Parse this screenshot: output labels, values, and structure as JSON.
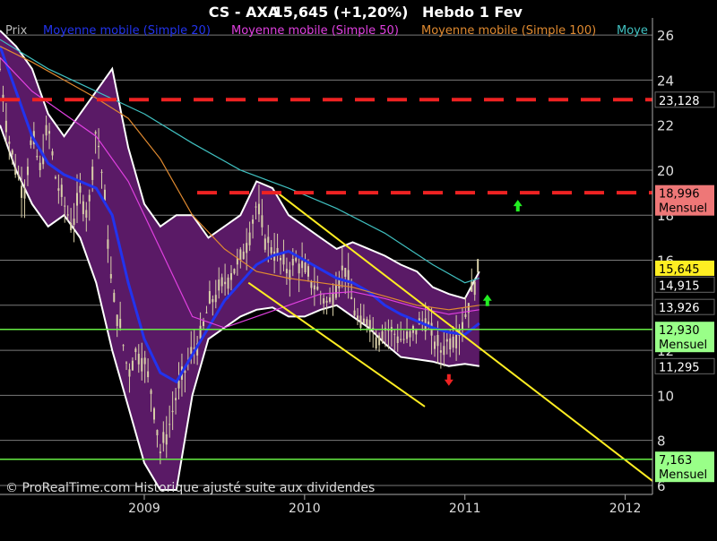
{
  "header": {
    "symbol": "CS - AXA",
    "price_change": "15,645 (+1,20%)",
    "period": "Hebdo  1 Fev"
  },
  "legend": [
    {
      "label": "Prix",
      "color": "#bbbbbb"
    },
    {
      "label": "Moyenne mobile (Simple 20)",
      "color": "#2233ee"
    },
    {
      "label": "Moyenne mobile (Simple 50)",
      "color": "#e040e0"
    },
    {
      "label": "Moyenne mobile (Simple 100)",
      "color": "#e08a30"
    },
    {
      "label": "Moye",
      "color": "#40c0c0"
    }
  ],
  "footer": {
    "copyright": "© ProRealTime.com Historique ajusté suite aux dividendes"
  },
  "colors": {
    "background": "#000000",
    "band_fill": "#5a1a66",
    "band_edge": "#ffffff",
    "candle": "#d8cfa8",
    "resistance": "#ee2222",
    "support": "#66ee44",
    "channel": "#ffee22",
    "grid": "#7a7a7a"
  },
  "chart_data": {
    "type": "line",
    "x_axis": {
      "labels": [
        "2009",
        "2010",
        "2011",
        "2012"
      ],
      "values": [
        2009,
        2010,
        2011,
        2012
      ],
      "range": [
        2008.1,
        2012.17
      ]
    },
    "y_axis": {
      "ticks": [
        6,
        8,
        10,
        12,
        14,
        16,
        18,
        20,
        22,
        24,
        26
      ],
      "range": [
        5.6,
        26.6
      ]
    },
    "price": {
      "x": [
        2008.1,
        2008.15,
        2008.2,
        2008.25,
        2008.3,
        2008.35,
        2008.4,
        2008.45,
        2008.5,
        2008.55,
        2008.6,
        2008.65,
        2008.7,
        2008.75,
        2008.8,
        2008.85,
        2008.9,
        2008.95,
        2009.0,
        2009.05,
        2009.1,
        2009.15,
        2009.2,
        2009.25,
        2009.3,
        2009.35,
        2009.4,
        2009.45,
        2009.5,
        2009.55,
        2009.6,
        2009.65,
        2009.7,
        2009.75,
        2009.8,
        2009.85,
        2009.9,
        2009.95,
        2010.0,
        2010.05,
        2010.1,
        2010.15,
        2010.2,
        2010.25,
        2010.3,
        2010.35,
        2010.4,
        2010.45,
        2010.5,
        2010.55,
        2010.6,
        2010.65,
        2010.7,
        2010.75,
        2010.8,
        2010.85,
        2010.9,
        2010.95,
        2011.0,
        2011.05,
        2011.09
      ],
      "y": [
        24.5,
        21.5,
        20.0,
        19.0,
        21.5,
        20.0,
        22.0,
        19.5,
        18.5,
        17.5,
        19.0,
        18.0,
        22.0,
        19.0,
        14.5,
        13.0,
        11.0,
        12.0,
        11.5,
        10.0,
        7.5,
        8.5,
        10.0,
        11.0,
        12.0,
        12.5,
        14.0,
        14.5,
        15.0,
        15.5,
        16.0,
        17.0,
        18.5,
        17.0,
        16.5,
        16.0,
        15.5,
        16.0,
        15.5,
        15.0,
        14.5,
        14.0,
        15.0,
        15.8,
        14.0,
        13.0,
        13.5,
        12.5,
        13.0,
        12.8,
        12.5,
        12.5,
        13.0,
        13.5,
        12.5,
        12.0,
        12.5,
        12.7,
        13.5,
        14.8,
        15.645
      ]
    },
    "series": [
      {
        "name": "Moyenne mobile (Simple 20)",
        "color": "#2233ee",
        "x": [
          2008.1,
          2008.2,
          2008.3,
          2008.4,
          2008.5,
          2008.6,
          2008.7,
          2008.8,
          2008.9,
          2009.0,
          2009.1,
          2009.2,
          2009.3,
          2009.4,
          2009.5,
          2009.6,
          2009.7,
          2009.8,
          2009.9,
          2010.0,
          2010.1,
          2010.2,
          2010.3,
          2010.4,
          2010.5,
          2010.6,
          2010.7,
          2010.8,
          2010.9,
          2011.0,
          2011.09
        ],
        "y": [
          25.5,
          23.5,
          21.5,
          20.3,
          19.8,
          19.5,
          19.2,
          18.0,
          15.0,
          12.5,
          11.0,
          10.6,
          11.8,
          13.0,
          14.2,
          15.0,
          15.8,
          16.2,
          16.4,
          16.0,
          15.6,
          15.2,
          15.0,
          14.6,
          14.0,
          13.6,
          13.3,
          13.0,
          12.8,
          12.7,
          13.2
        ]
      },
      {
        "name": "Moyenne mobile (Simple 50)",
        "color": "#e040e0",
        "x": [
          2008.1,
          2008.3,
          2008.5,
          2008.7,
          2008.9,
          2009.1,
          2009.3,
          2009.5,
          2009.7,
          2009.9,
          2010.1,
          2010.3,
          2010.5,
          2010.7,
          2010.9,
          2011.09
        ],
        "y": [
          25.0,
          23.5,
          22.5,
          21.5,
          19.5,
          16.5,
          13.5,
          13.0,
          13.5,
          14.0,
          14.5,
          14.6,
          14.3,
          13.9,
          13.6,
          13.8
        ]
      },
      {
        "name": "Moyenne mobile (Simple 100)",
        "color": "#e08a30",
        "x": [
          2008.1,
          2008.3,
          2008.5,
          2008.7,
          2008.9,
          2009.1,
          2009.3,
          2009.5,
          2009.7,
          2009.9,
          2010.1,
          2010.3,
          2010.5,
          2010.7,
          2010.9,
          2011.09
        ],
        "y": [
          25.5,
          24.8,
          24.0,
          23.2,
          22.3,
          20.5,
          18.0,
          16.5,
          15.5,
          15.2,
          15.0,
          14.8,
          14.4,
          14.0,
          13.8,
          14.0
        ]
      },
      {
        "name": "Moye",
        "color": "#40c0c0",
        "x": [
          2008.1,
          2008.4,
          2008.7,
          2009.0,
          2009.3,
          2009.6,
          2009.9,
          2010.2,
          2010.5,
          2010.8,
          2011.0,
          2011.09
        ],
        "y": [
          25.8,
          24.5,
          23.5,
          22.5,
          21.2,
          20.0,
          19.2,
          18.3,
          17.2,
          15.8,
          15.0,
          15.2
        ]
      }
    ],
    "bollinger": {
      "x": [
        2008.1,
        2008.2,
        2008.3,
        2008.4,
        2008.5,
        2008.6,
        2008.7,
        2008.8,
        2008.9,
        2009.0,
        2009.1,
        2009.2,
        2009.3,
        2009.4,
        2009.5,
        2009.6,
        2009.7,
        2009.8,
        2009.9,
        2010.0,
        2010.1,
        2010.2,
        2010.3,
        2010.4,
        2010.5,
        2010.6,
        2010.7,
        2010.8,
        2010.9,
        2011.0,
        2011.09
      ],
      "upper": [
        26.2,
        25.5,
        24.5,
        22.5,
        21.5,
        22.5,
        23.5,
        24.5,
        21.0,
        18.5,
        17.5,
        18.0,
        18.0,
        17.0,
        17.5,
        18.0,
        19.5,
        19.2,
        18.0,
        17.5,
        17.0,
        16.5,
        16.8,
        16.5,
        16.2,
        15.8,
        15.5,
        14.8,
        14.5,
        14.3,
        15.5
      ],
      "lower": [
        22.0,
        20.0,
        18.5,
        17.5,
        18.0,
        17.0,
        15.0,
        12.0,
        9.5,
        7.0,
        5.8,
        5.8,
        10.0,
        12.5,
        13.0,
        13.5,
        13.8,
        13.9,
        13.5,
        13.5,
        13.8,
        14.0,
        13.5,
        13.0,
        12.3,
        11.7,
        11.6,
        11.5,
        11.3,
        11.4,
        11.3
      ]
    },
    "levels": [
      {
        "value": 23.128,
        "label": "23,128",
        "style": "dashed",
        "x_start": 2008.1,
        "color": "#ee2222",
        "text": "#ffffff",
        "box": "#000000"
      },
      {
        "value": 18.996,
        "label": "18,996",
        "tag": "Mensuel",
        "style": "dashed",
        "x_start": 2009.33,
        "color": "#ee2222",
        "text": "#000000",
        "box": "#ee7777"
      },
      {
        "value": 12.93,
        "label": "12,930",
        "tag": "Mensuel",
        "style": "solid",
        "x_start": 2008.1,
        "color": "#66ee44",
        "text": "#000000",
        "box": "#99ff88"
      },
      {
        "value": 7.163,
        "label": "7,163",
        "tag": "Mensuel",
        "style": "solid",
        "x_start": 2008.1,
        "color": "#66ee44",
        "text": "#000000",
        "box": "#99ff88"
      }
    ],
    "value_tags": [
      {
        "value": 15.645,
        "label": "15,645",
        "text": "#000000",
        "box": "#ffee22"
      },
      {
        "value": 14.915,
        "label": "14,915",
        "text": "#ffffff",
        "box": "#000000"
      },
      {
        "value": 13.926,
        "label": "13,926",
        "text": "#ffffff",
        "box": "#000000"
      },
      {
        "value": 11.295,
        "label": "11,295",
        "text": "#ffffff",
        "box": "#000000"
      }
    ],
    "trendlines": [
      {
        "x1": 2009.83,
        "y1": 19.0,
        "x2": 2012.17,
        "y2": 6.2,
        "color": "#ffee22"
      },
      {
        "x1": 2009.65,
        "y1": 15.0,
        "x2": 2010.75,
        "y2": 9.5,
        "color": "#ffee22"
      }
    ],
    "arrows": [
      {
        "x": 2011.33,
        "y": 18.4,
        "direction": "up",
        "color": "#22ee22"
      },
      {
        "x": 2011.14,
        "y": 14.2,
        "direction": "up",
        "color": "#22ee22"
      },
      {
        "x": 2010.9,
        "y": 10.7,
        "direction": "down",
        "color": "#ee2222"
      }
    ]
  }
}
